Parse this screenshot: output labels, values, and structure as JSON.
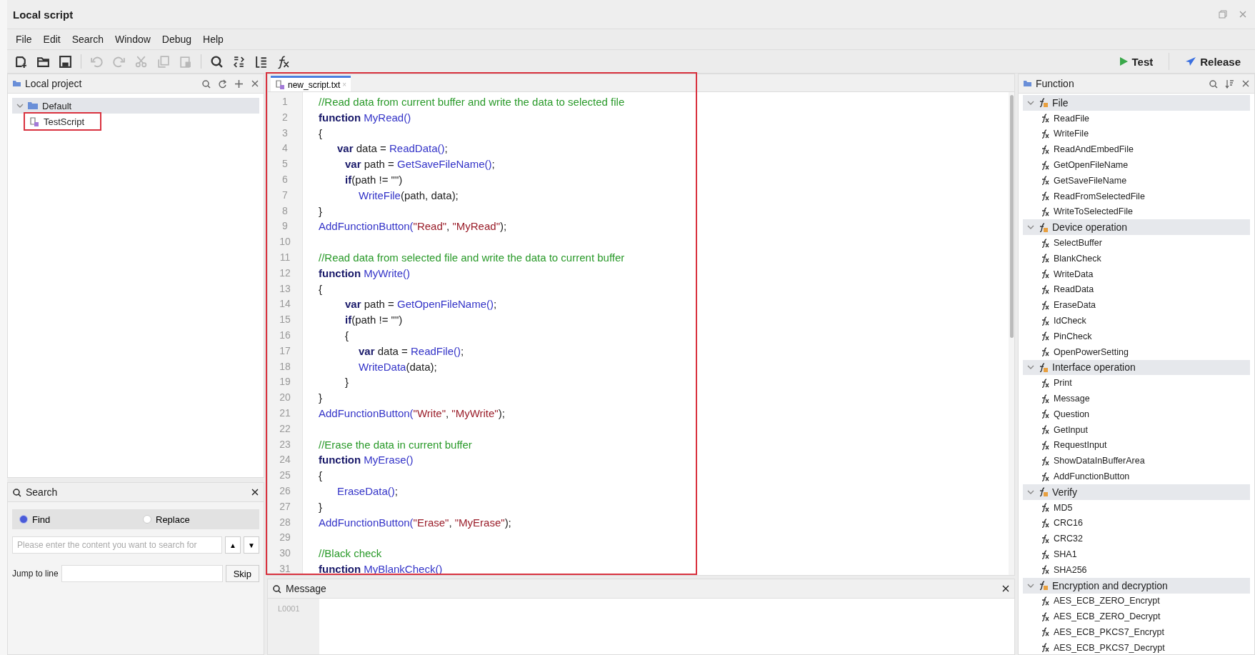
{
  "window": {
    "title": "Local script"
  },
  "menu": [
    "File",
    "Edit",
    "Search",
    "Window",
    "Debug",
    "Help"
  ],
  "toolbar": [
    {
      "kind": "new",
      "disabled": false
    },
    {
      "kind": "open",
      "disabled": false
    },
    {
      "kind": "save",
      "disabled": false
    },
    {
      "kind": "sep"
    },
    {
      "kind": "undo",
      "disabled": true
    },
    {
      "kind": "redo",
      "disabled": true
    },
    {
      "kind": "cut",
      "disabled": true
    },
    {
      "kind": "copy",
      "disabled": true
    },
    {
      "kind": "paste",
      "disabled": true
    },
    {
      "kind": "sep"
    },
    {
      "kind": "search",
      "disabled": false
    },
    {
      "kind": "replace",
      "disabled": false
    },
    {
      "kind": "indent",
      "disabled": false
    },
    {
      "kind": "function",
      "disabled": false
    }
  ],
  "actions": [
    {
      "kind": "test",
      "label": "Test"
    },
    {
      "kind": "release",
      "label": "Release"
    }
  ],
  "project": {
    "title": "Local project",
    "tree": [
      {
        "label": "Default",
        "expanded": true,
        "selected": true,
        "children": [
          {
            "label": "TestScript",
            "selected": false,
            "highlighted": true
          }
        ]
      }
    ]
  },
  "search": {
    "title": "Search",
    "modes": [
      {
        "label": "Find",
        "selected": true
      },
      {
        "label": "Replace",
        "selected": false
      }
    ],
    "placeholder": "Please enter the content you want to search for",
    "up": "▲",
    "down": "▼",
    "jump_label": "Jump to line",
    "skip": "Skip"
  },
  "editor": {
    "tabs": [
      {
        "label": "new_script.txt",
        "close": "×",
        "selected": true
      }
    ],
    "highlighted": true,
    "lines": [
      {
        "number": "1",
        "tokens": [
          {
            "kind": "comment",
            "text": "//Read data from current buffer and write the data to selected file"
          }
        ]
      },
      {
        "number": "2",
        "tokens": [
          {
            "kind": "keyword",
            "text": "function"
          },
          {
            "kind": "func",
            "text": "MyRead()"
          }
        ]
      },
      {
        "number": "3",
        "tokens": [
          {
            "kind": "plain",
            "text": "{"
          }
        ]
      },
      {
        "number": "4",
        "kind": "inner",
        "tokens": [
          {
            "kind": "keyword",
            "text": "var"
          },
          {
            "kind": "plain",
            "text": " data = "
          },
          {
            "kind": "func",
            "text": "ReadData()"
          },
          {
            "kind": "plain",
            "text": ";"
          }
        ]
      },
      {
        "number": "5",
        "kind": "nested",
        "tokens": [
          {
            "kind": "keyword",
            "text": "var"
          },
          {
            "kind": "plain",
            "text": " path = "
          },
          {
            "kind": "func",
            "text": "GetSaveFileName()"
          },
          {
            "kind": "plain",
            "text": ";"
          }
        ]
      },
      {
        "number": "6",
        "kind": "nested",
        "tokens": [
          {
            "kind": "keyword",
            "text": "if"
          },
          {
            "kind": "plain",
            "text": "(path != \"\")"
          }
        ]
      },
      {
        "number": "7",
        "kind": "deep",
        "tokens": [
          {
            "kind": "func",
            "text": "WriteFile"
          },
          {
            "kind": "plain",
            "text": "(path, data);"
          }
        ]
      },
      {
        "number": "8",
        "tokens": [
          {
            "kind": "plain",
            "text": "}"
          }
        ]
      },
      {
        "number": "9",
        "tokens": [
          {
            "kind": "func",
            "text": "AddFunctionButton("
          },
          {
            "kind": "string",
            "text": "\"Read\""
          },
          {
            "kind": "plain",
            "text": ", "
          },
          {
            "kind": "string",
            "text": "\"MyRead\""
          },
          {
            "kind": "plain",
            "text": ");"
          }
        ]
      },
      {
        "number": "10"
      },
      {
        "number": "11",
        "tokens": [
          {
            "kind": "comment",
            "text": "//Read data from selected file and write the data to current buffer"
          }
        ]
      },
      {
        "number": "12",
        "tokens": [
          {
            "kind": "keyword",
            "text": "function"
          },
          {
            "kind": "func",
            "text": "MyWrite()"
          }
        ]
      },
      {
        "number": "13",
        "tokens": [
          {
            "kind": "plain",
            "text": "{"
          }
        ]
      },
      {
        "number": "14",
        "kind": "nested",
        "tokens": [
          {
            "kind": "keyword",
            "text": "var"
          },
          {
            "kind": "plain",
            "text": " path = "
          },
          {
            "kind": "func",
            "text": "GetOpenFileName()"
          },
          {
            "kind": "plain",
            "text": ";"
          }
        ]
      },
      {
        "number": "15",
        "kind": "nested",
        "tokens": [
          {
            "kind": "keyword",
            "text": "if"
          },
          {
            "kind": "plain",
            "text": "(path != \"\")"
          }
        ]
      },
      {
        "number": "16",
        "kind": "nested",
        "tokens": [
          {
            "kind": "plain",
            "text": "{"
          }
        ]
      },
      {
        "number": "17",
        "kind": "deep",
        "tokens": [
          {
            "kind": "keyword",
            "text": "var"
          },
          {
            "kind": "plain",
            "text": " data = "
          },
          {
            "kind": "func",
            "text": "ReadFile()"
          },
          {
            "kind": "plain",
            "text": ";"
          }
        ]
      },
      {
        "number": "18",
        "kind": "deep",
        "tokens": [
          {
            "kind": "func",
            "text": "WriteData"
          },
          {
            "kind": "plain",
            "text": "(data);"
          }
        ]
      },
      {
        "number": "19",
        "kind": "nested",
        "tokens": [
          {
            "kind": "plain",
            "text": "}"
          }
        ]
      },
      {
        "number": "20",
        "tokens": [
          {
            "kind": "plain",
            "text": "}"
          }
        ]
      },
      {
        "number": "21",
        "tokens": [
          {
            "kind": "func",
            "text": "AddFunctionButton("
          },
          {
            "kind": "string",
            "text": "\"Write\""
          },
          {
            "kind": "plain",
            "text": ", "
          },
          {
            "kind": "string",
            "text": "\"MyWrite\""
          },
          {
            "kind": "plain",
            "text": ");"
          }
        ]
      },
      {
        "number": "22"
      },
      {
        "number": "23",
        "tokens": [
          {
            "kind": "comment",
            "text": "//Erase the data in current buffer"
          }
        ]
      },
      {
        "number": "24",
        "tokens": [
          {
            "kind": "keyword",
            "text": "function"
          },
          {
            "kind": "func",
            "text": "MyErase()"
          }
        ]
      },
      {
        "number": "25",
        "tokens": [
          {
            "kind": "plain",
            "text": "{"
          }
        ]
      },
      {
        "number": "26",
        "kind": "inner",
        "tokens": [
          {
            "kind": "func",
            "text": "EraseData()"
          },
          {
            "kind": "plain",
            "text": ";"
          }
        ]
      },
      {
        "number": "27",
        "tokens": [
          {
            "kind": "plain",
            "text": "}"
          }
        ]
      },
      {
        "number": "28",
        "tokens": [
          {
            "kind": "func",
            "text": "AddFunctionButton("
          },
          {
            "kind": "string",
            "text": "\"Erase\""
          },
          {
            "kind": "plain",
            "text": ", "
          },
          {
            "kind": "string",
            "text": "\"MyErase\""
          },
          {
            "kind": "plain",
            "text": ");"
          }
        ]
      },
      {
        "number": "29"
      },
      {
        "number": "30",
        "tokens": [
          {
            "kind": "comment",
            "text": "//Black check"
          }
        ]
      },
      {
        "number": "31",
        "tokens": [
          {
            "kind": "keyword",
            "text": "function"
          },
          {
            "kind": "func",
            "text": "MyBlankCheck()"
          }
        ]
      }
    ]
  },
  "message": {
    "title": "Message",
    "lines": [
      "L0001"
    ]
  },
  "functions": {
    "title": "Function",
    "groups": [
      {
        "label": "File",
        "expanded": true,
        "items": [
          "ReadFile",
          "WriteFile",
          "ReadAndEmbedFile",
          "GetOpenFileName",
          "GetSaveFileName",
          "ReadFromSelectedFile",
          "WriteToSelectedFile"
        ]
      },
      {
        "label": "Device operation",
        "expanded": true,
        "items": [
          "SelectBuffer",
          "BlankCheck",
          "WriteData",
          "ReadData",
          "EraseData",
          "IdCheck",
          "PinCheck",
          "OpenPowerSetting"
        ]
      },
      {
        "label": "Interface operation",
        "expanded": true,
        "items": [
          "Print",
          "Message",
          "Question",
          "GetInput",
          "RequestInput",
          "ShowDataInBufferArea",
          "AddFunctionButton"
        ]
      },
      {
        "label": "Verify",
        "expanded": true,
        "items": [
          "MD5",
          "CRC16",
          "CRC32",
          "SHA1",
          "SHA256"
        ]
      },
      {
        "label": "Encryption and decryption",
        "expanded": true,
        "items": [
          "AES_ECB_ZERO_Encrypt",
          "AES_ECB_ZERO_Decrypt",
          "AES_ECB_PKCS7_Encrypt",
          "AES_ECB_PKCS7_Decrypt"
        ]
      }
    ]
  }
}
